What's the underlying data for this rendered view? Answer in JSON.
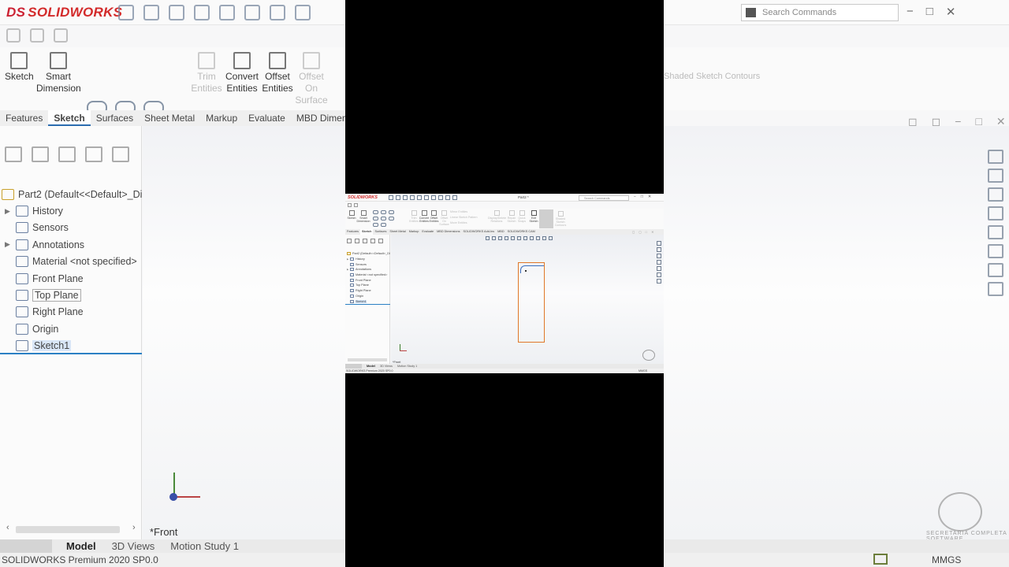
{
  "app": {
    "brand": "SOLIDWORKS",
    "document_title": "Part2 *",
    "search_placeholder": "Search Commands",
    "window_controls": [
      "−",
      "□",
      "✕"
    ]
  },
  "command_manager": {
    "sketch": "Sketch",
    "smart_dimension": "Smart Dimension",
    "trim_entities": "Trim Entities",
    "convert_entities": "Convert Entities",
    "offset_entities": "Offset Entities",
    "offset_on_surface": "Offset On Surface",
    "mirror_entities": "Mirror Entities",
    "linear_sketch_pattern": "Linear Sketch Pattern",
    "move_entities": "Move Entities",
    "display_delete_relations": "Display/Delete Relations",
    "repair_sketch": "Repair Sketch",
    "quick_snaps": "Quick Snaps",
    "rapid_sketch": "Rapid Sketch",
    "exit_sketch": "Exit Sketch",
    "instant2d": "Instant2D",
    "shaded_sketch_contours": "Shaded Sketch Contours"
  },
  "tabs": [
    "Features",
    "Sketch",
    "Surfaces",
    "Sheet Metal",
    "Markup",
    "Evaluate",
    "MBD Dimensions",
    "SOLIDWORKS Add-Ins",
    "MBD",
    "SOLIDWORKS CAM"
  ],
  "active_tab": "Sketch",
  "feature_tree": {
    "root": "Part2  (Default<<Default>_Di",
    "items": [
      {
        "label": "History",
        "expandable": true
      },
      {
        "label": "Sensors",
        "expandable": false
      },
      {
        "label": "Annotations",
        "expandable": true
      },
      {
        "label": "Material <not specified>",
        "expandable": false
      },
      {
        "label": "Front Plane",
        "expandable": false
      },
      {
        "label": "Top Plane",
        "expandable": false
      },
      {
        "label": "Right Plane",
        "expandable": false
      },
      {
        "label": "Origin",
        "expandable": false
      },
      {
        "label": "Sketch1",
        "expandable": false
      }
    ]
  },
  "viewport": {
    "view_name": "*Front",
    "sketch_color": "#e07828"
  },
  "bottom_tabs": [
    "Model",
    "3D Views",
    "Motion Study 1"
  ],
  "active_bottom_tab": "Model",
  "status": {
    "version": "SOLIDWORKS Premium 2020 SP0.0",
    "units": "MMGS"
  },
  "watermark": "SECRETARIA COMPLETA SOFTWARE",
  "colors": {
    "brand_red": "#d32a2a",
    "selection_blue": "#2b80c4",
    "sketch_orange": "#e07828"
  }
}
